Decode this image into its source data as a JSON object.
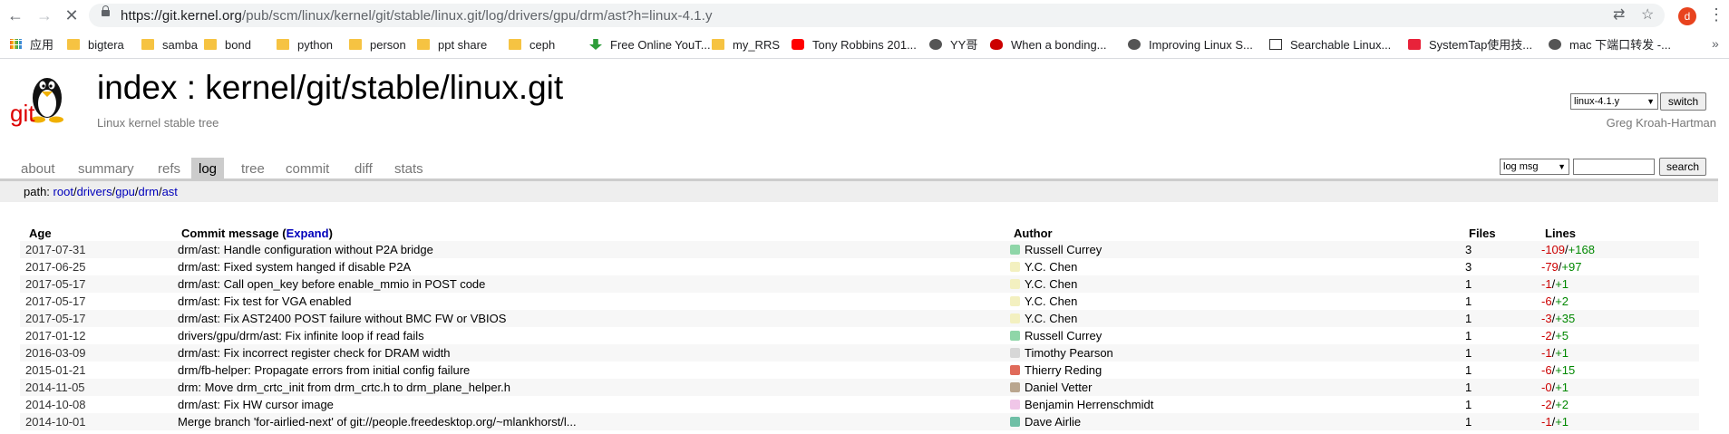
{
  "browser": {
    "url_host": "https://git.kernel.org",
    "url_path": "/pub/scm/linux/kernel/git/stable/linux.git/log/drivers/gpu/drm/ast?h=linux-4.1.y",
    "profile_initial": "d",
    "bookmarks": [
      {
        "label": "应用",
        "icon": "apps-icon"
      },
      {
        "label": "bigtera",
        "icon": "folder-icon"
      },
      {
        "label": "samba",
        "icon": "folder-icon"
      },
      {
        "label": "bond",
        "icon": "folder-icon"
      },
      {
        "label": "python",
        "icon": "folder-icon"
      },
      {
        "label": "person",
        "icon": "folder-icon"
      },
      {
        "label": "ppt share",
        "icon": "folder-icon"
      },
      {
        "label": "ceph",
        "icon": "folder-icon"
      },
      {
        "label": "Free Online YouT...",
        "icon": "download-arrow-icon"
      },
      {
        "label": "my_RRS",
        "icon": "folder-icon"
      },
      {
        "label": "Tony Robbins 201...",
        "icon": "youtube-icon"
      },
      {
        "label": "YY哥",
        "icon": "globe-icon"
      },
      {
        "label": "When a bonding...",
        "icon": "redhat-icon"
      },
      {
        "label": "Improving Linux S...",
        "icon": "site-icon"
      },
      {
        "label": "Searchable Linux...",
        "icon": "zero-icon"
      },
      {
        "label": "SystemTap使用技...",
        "icon": "csdn-icon"
      },
      {
        "label": "mac 下端口转发 -...",
        "icon": "site-icon"
      }
    ]
  },
  "repo": {
    "title": "index : kernel/git/stable/linux.git",
    "description": "Linux kernel stable tree",
    "owner": "Greg Kroah-Hartman",
    "branch": "linux-4.1.y",
    "switch_label": "switch",
    "logo_text": "git"
  },
  "tabs": [
    "about",
    "summary",
    "refs",
    "log",
    "tree",
    "commit",
    "diff",
    "stats"
  ],
  "active_tab": "log",
  "search": {
    "type": "log msg",
    "button": "search"
  },
  "path": {
    "label": "path:",
    "segments": [
      "root",
      "drivers",
      "gpu",
      "drm",
      "ast"
    ]
  },
  "log": {
    "headers": {
      "age": "Age",
      "message": "Commit message",
      "expand": "Expand",
      "author": "Author",
      "files": "Files",
      "lines": "Lines"
    },
    "rows": [
      {
        "age": "2017-07-31",
        "message": "drm/ast: Handle configuration without P2A bridge",
        "author": "Russell Currey",
        "files": "3",
        "del": "-109",
        "add": "+168",
        "avatar_color": "#8fd6a8"
      },
      {
        "age": "2017-06-25",
        "message": "drm/ast: Fixed system hanged if disable P2A",
        "author": "Y.C. Chen",
        "files": "3",
        "del": "-79",
        "add": "+97",
        "avatar_color": "#f3f0c0"
      },
      {
        "age": "2017-05-17",
        "message": "drm/ast: Call open_key before enable_mmio in POST code",
        "author": "Y.C. Chen",
        "files": "1",
        "del": "-1",
        "add": "+1",
        "avatar_color": "#f3f0c0"
      },
      {
        "age": "2017-05-17",
        "message": "drm/ast: Fix test for VGA enabled",
        "author": "Y.C. Chen",
        "files": "1",
        "del": "-6",
        "add": "+2",
        "avatar_color": "#f3f0c0"
      },
      {
        "age": "2017-05-17",
        "message": "drm/ast: Fix AST2400 POST failure without BMC FW or VBIOS",
        "author": "Y.C. Chen",
        "files": "1",
        "del": "-3",
        "add": "+35",
        "avatar_color": "#f3f0c0"
      },
      {
        "age": "2017-01-12",
        "message": "drivers/gpu/drm/ast: Fix infinite loop if read fails",
        "author": "Russell Currey",
        "files": "1",
        "del": "-2",
        "add": "+5",
        "avatar_color": "#8fd6a8"
      },
      {
        "age": "2016-03-09",
        "message": "drm/ast: Fix incorrect register check for DRAM width",
        "author": "Timothy Pearson",
        "files": "1",
        "del": "-1",
        "add": "+1",
        "avatar_color": "#d7d7d7"
      },
      {
        "age": "2015-01-21",
        "message": "drm/fb-helper: Propagate errors from initial config failure",
        "author": "Thierry Reding",
        "files": "1",
        "del": "-6",
        "add": "+15",
        "avatar_color": "#e06a5a"
      },
      {
        "age": "2014-11-05",
        "message": "drm: Move drm_crtc_init from drm_crtc.h to drm_plane_helper.h",
        "author": "Daniel Vetter",
        "files": "1",
        "del": "-0",
        "add": "+1",
        "avatar_color": "#b9a58e"
      },
      {
        "age": "2014-10-08",
        "message": "drm/ast: Fix HW cursor image",
        "author": "Benjamin Herrenschmidt",
        "files": "1",
        "del": "-2",
        "add": "+2",
        "avatar_color": "#f0c6e8"
      },
      {
        "age": "2014-10-01",
        "message": "Merge branch 'for-airlied-next' of git://people.freedesktop.org/~mlankhorst/l...",
        "author": "Dave Airlie",
        "files": "1",
        "del": "-1",
        "add": "+1",
        "avatar_color": "#6fbfa6"
      }
    ]
  }
}
